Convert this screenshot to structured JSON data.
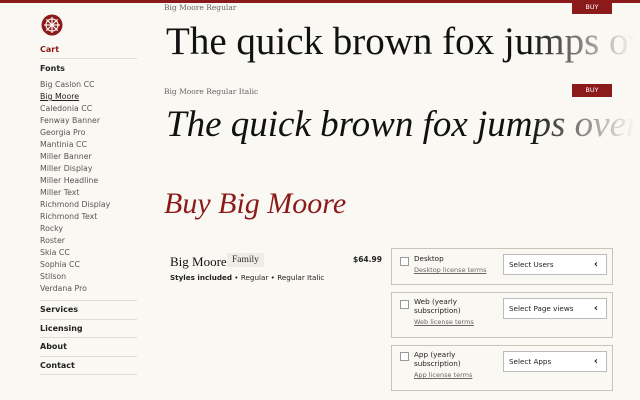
{
  "sidebar": {
    "cart_label": "Cart",
    "fonts_heading": "Fonts",
    "fonts": [
      "Big Caslon CC",
      "Big Moore",
      "Caledonia CC",
      "Fenway Banner",
      "Georgia Pro",
      "Mantinia CC",
      "Miller Banner",
      "Miller Display",
      "Miller Headline",
      "Miller Text",
      "Richmond Display",
      "Richmond Text",
      "Rocky",
      "Roster",
      "Skia CC",
      "Sophia CC",
      "Stilson",
      "Verdana Pro"
    ],
    "active_font": "Big Moore",
    "nav": [
      "Services",
      "Licensing",
      "About",
      "Contact"
    ]
  },
  "specimens": [
    {
      "label": "Big Moore Regular",
      "sample": "The quick brown fox jumps over",
      "buy": "BUY"
    },
    {
      "label": "Big Moore Regular Italic",
      "sample": "The quick brown fox jumps over",
      "buy": "BUY"
    }
  ],
  "buy_heading": "Buy Big Moore",
  "product": {
    "name": "Big Moore",
    "tag": "Family",
    "price": "$64.99",
    "styles_label": "Styles included",
    "styles": "Regular • Regular Italic"
  },
  "licenses": [
    {
      "title": "Desktop",
      "link": "Desktop license terms",
      "select": "Select Users"
    },
    {
      "title": "Web (yearly subscription)",
      "link": "Web license terms",
      "select": "Select Page views"
    },
    {
      "title": "App (yearly subscription)",
      "link": "App license terms",
      "select": "Select Apps"
    }
  ],
  "colors": {
    "accent": "#8b1a1a",
    "background": "#faf8f3"
  }
}
